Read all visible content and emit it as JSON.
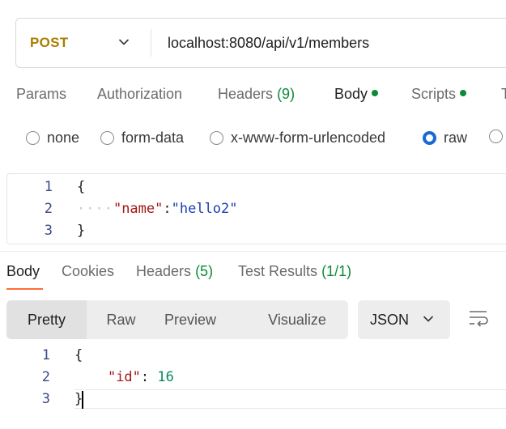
{
  "request": {
    "method": "POST",
    "url": "localhost:8080/api/v1/members"
  },
  "request_tabs": [
    {
      "label": "Params"
    },
    {
      "label": "Authorization"
    },
    {
      "label": "Headers",
      "count": "(9)"
    },
    {
      "label": "Body",
      "dot": true,
      "active": true
    },
    {
      "label": "Scripts",
      "dot": true
    },
    {
      "label": "T"
    }
  ],
  "body_types": [
    {
      "label": "none"
    },
    {
      "label": "form-data"
    },
    {
      "label": "x-www-form-urlencoded"
    },
    {
      "label": "raw",
      "selected": true
    },
    {
      "label": ""
    }
  ],
  "request_body": {
    "line_numbers": [
      "1",
      "2",
      "3"
    ],
    "open_brace": "{",
    "indent_dots": "····",
    "key": "\"name\"",
    "colon": ":",
    "value": "\"hello2\"",
    "close_brace": "}"
  },
  "response_tabs": [
    {
      "label": "Body",
      "active": true
    },
    {
      "label": "Cookies"
    },
    {
      "label": "Headers",
      "count": "(5)"
    },
    {
      "label": "Test Results",
      "count": "(1/1)"
    }
  ],
  "view_modes": [
    "Pretty",
    "Raw",
    "Preview",
    "Visualize"
  ],
  "format": "JSON",
  "response_body": {
    "line_numbers": [
      "1",
      "2",
      "3"
    ],
    "open_brace": "{",
    "key": "\"id\"",
    "colon": ": ",
    "value": "16",
    "close_brace": "}"
  },
  "colors": {
    "method": "#ab7e00",
    "accent": "#ff6c37",
    "green": "#0c8a38",
    "radio_selected": "#1a6bd1"
  }
}
